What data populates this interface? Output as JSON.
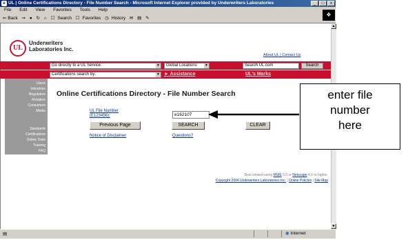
{
  "window": {
    "title": "UL | Online Certifications Directory - File Number Search - Microsoft Internet Explorer provided by Underwriters Laboratories",
    "min": "_",
    "max": "□",
    "close": "x"
  },
  "menu": [
    "File",
    "Edit",
    "View",
    "Favorites",
    "Tools",
    "Help"
  ],
  "toolbar": {
    "back": "⇐ Back",
    "forward": "⇒",
    "search": "Search",
    "favorites": "Favorites",
    "history": "History"
  },
  "header": {
    "company_line1": "Underwriters",
    "company_line2": "Laboratories Inc.",
    "logo_text": "UL",
    "about": "About UL",
    "contact": "Contact Us"
  },
  "band": {
    "go_directly": "Go directly to a UL Service:",
    "global_locations": "Global Locations",
    "search_field": "Search UL.com",
    "search_button": "Search",
    "cert_search": "Certifications search by:",
    "assistance": "Assistance",
    "marks": "UL's Marks"
  },
  "leftnav": {
    "group1": [
      "Users",
      "Industries",
      "Regulators",
      "Retailers",
      "Consumers",
      "Media"
    ],
    "group2": [
      "Standards",
      "Certifications",
      "Online Tools",
      "Training",
      "FAQ"
    ]
  },
  "main": {
    "title": "Online Certifications Directory - File Number Search",
    "fn_label_line1": "UL File Number",
    "fn_label_line2": "(E123456):",
    "fn_value": "e162107",
    "previous_page": "Previous Page",
    "search": "SEARCH",
    "clear": "CLEAR",
    "disclaimer": "Notice of Disclaimer",
    "questions": "Questions?"
  },
  "footer": {
    "viewed_prefix": "Best viewed using",
    "msie": "MSIE",
    "viewed_mid": "5.0 or",
    "netscape": "Netscape",
    "viewed_suffix": "4.0 or higher.",
    "copyright": "Copyright 2004 Underwriters Laboratories Inc.",
    "policies": "Online Policies",
    "sitemap": "Site Map"
  },
  "callout": {
    "line1": "enter file",
    "line2": "number",
    "line3": "here"
  },
  "status": {
    "zone": "Internet"
  }
}
